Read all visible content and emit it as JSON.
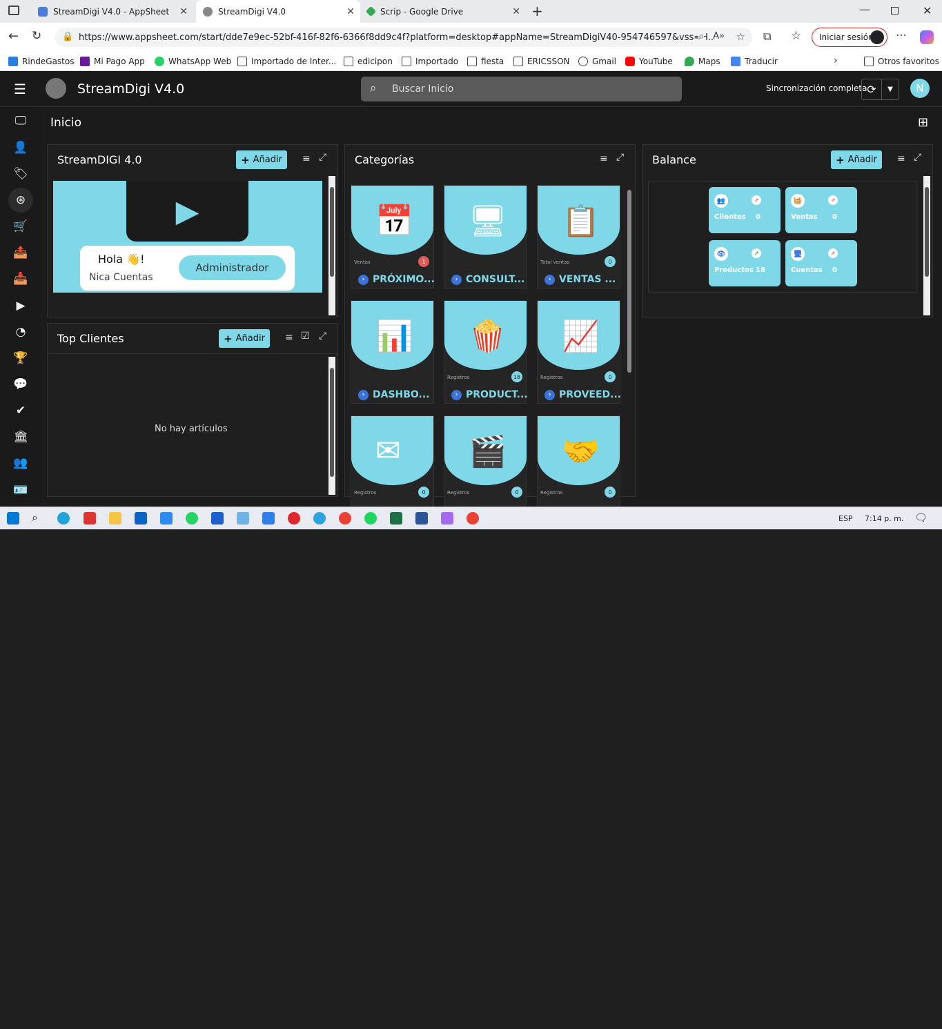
{
  "browser": {
    "tabs": [
      {
        "title": "StreamDigi V4.0 - AppSheet",
        "color": "#4a7bd8"
      },
      {
        "title": "StreamDigi V4.0",
        "color": "#888888"
      },
      {
        "title": "Scrip - Google Drive",
        "color": "#34a853"
      }
    ],
    "url": "https://www.appsheet.com/start/dde7e9ec-52bf-416f-82f6-6366f8dd9c4f?platform=desktop#appName=StreamDigiV40-954746597&vss=H...",
    "signin_label": "Iniciar sesión",
    "bookmarks": [
      "RindeGastos",
      "Mi Pago App",
      "WhatsApp Web",
      "Importado de Inter...",
      "edicipon",
      "Importado",
      "fiesta",
      "ERICSSON",
      "Gmail",
      "YouTube",
      "Maps",
      "Traducir"
    ],
    "other_favorites": "Otros favoritos"
  },
  "app": {
    "title": "StreamDigi V4.0",
    "search_placeholder": "Buscar Inicio",
    "sync_status": "Sincronización completa",
    "user_initial": "N",
    "page_title": "Inicio",
    "accent": "#7fd8e8"
  },
  "panels": {
    "streamdigi": {
      "title": "StreamDIGI 4.0",
      "add_label": "Añadir",
      "greeting": "Hola 👋!",
      "subtitle": "Nica Cuentas",
      "role_button": "Administrador"
    },
    "top_clientes": {
      "title": "Top Clientes",
      "add_label": "Añadir",
      "empty": "No hay artículos"
    },
    "categorias": {
      "title": "Categorías",
      "cards": [
        {
          "label": "PRÓXIMO...",
          "sub": "Ventas",
          "badge": "1",
          "badge_color": "#e05a5a",
          "icon": "calendar-icon",
          "glyph": "📅"
        },
        {
          "label": "CONSULT...",
          "sub": "",
          "badge": "",
          "badge_color": "",
          "icon": "browser-window-icon",
          "glyph": "🖥"
        },
        {
          "label": "VENTAS ...",
          "sub": "Total ventas",
          "badge": "0",
          "badge_color": "#7fd8e8",
          "icon": "clipboard-chart-icon",
          "glyph": "📋"
        },
        {
          "label": "DASHBO...",
          "sub": "",
          "badge": "",
          "badge_color": "",
          "icon": "dashboard-icon",
          "glyph": "📊"
        },
        {
          "label": "PRODUCT...",
          "sub": "Registros",
          "badge": "18",
          "badge_color": "#7fd8e8",
          "icon": "popcorn-icon",
          "glyph": "🍿"
        },
        {
          "label": "PROVEED...",
          "sub": "Registros",
          "badge": "0",
          "badge_color": "#7fd8e8",
          "icon": "gauge-window-icon",
          "glyph": "📈"
        },
        {
          "label": "",
          "sub": "Registros",
          "badge": "0",
          "badge_color": "#7fd8e8",
          "icon": "mail-monitor-icon",
          "glyph": "✉"
        },
        {
          "label": "",
          "sub": "Registros",
          "badge": "0",
          "badge_color": "#7fd8e8",
          "icon": "streaming-apps-icon",
          "glyph": "🎬"
        },
        {
          "label": "",
          "sub": "Registros",
          "badge": "0",
          "badge_color": "#7fd8e8",
          "icon": "handshake-icon",
          "glyph": "🤝"
        }
      ]
    },
    "balance": {
      "title": "Balance",
      "add_label": "Añadir",
      "stats": [
        {
          "name": "Clientes",
          "value": "0",
          "icon": "users-icon",
          "glyph": "👥"
        },
        {
          "name": "Ventas",
          "value": "0",
          "icon": "basket-icon",
          "glyph": "🧺"
        },
        {
          "name": "Productos",
          "value": "18",
          "icon": "eye-icon",
          "glyph": "👁"
        },
        {
          "name": "Cuentas",
          "value": "0",
          "icon": "monitor-icon",
          "glyph": "🖥"
        }
      ]
    }
  },
  "taskbar": {
    "lang": "ESP",
    "time": "7:14 p. m."
  }
}
